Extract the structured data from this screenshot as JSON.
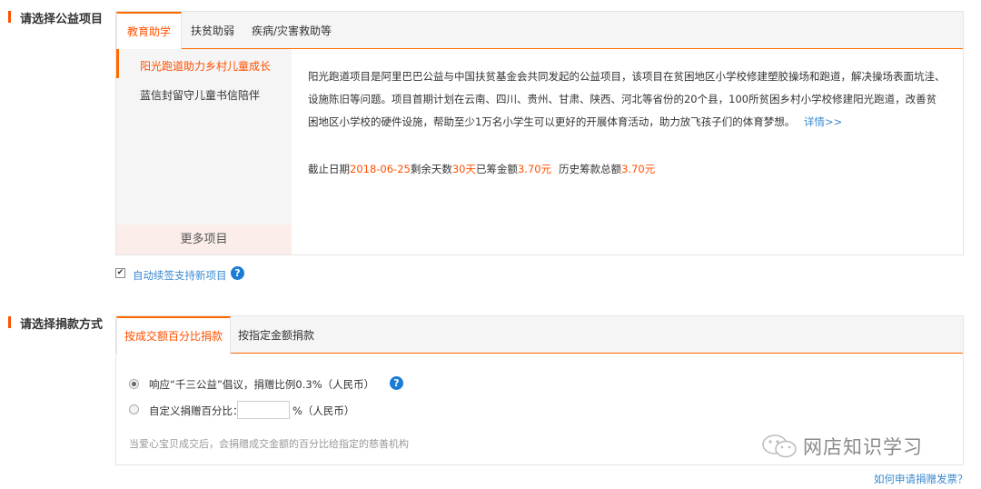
{
  "section1": {
    "label": "请选择公益项目",
    "tabs": [
      "教育助学",
      "扶贫助弱",
      "疾病/灾害救助等"
    ],
    "projects": [
      "阳光跑道助力乡村儿童成长",
      "蓝信封留守儿童书信陪伴"
    ],
    "more": "更多项目",
    "description": "阳光跑道项目是阿里巴巴公益与中国扶贫基金会共同发起的公益项目，该项目在贫困地区小学校修建塑胶操场和跑道，解决操场表面坑洼、设施陈旧等问题。项目首期计划在云南、四川、贵州、甘肃、陕西、河北等省份的20个县，100所贫困乡村小学校修建阳光跑道，改善贫困地区小学校的硬件设施，帮助至少1万名小学生可以更好的开展体育活动，助力放飞孩子们的体育梦想。",
    "detail_link": "详情>>",
    "stats": {
      "deadline_label": "截止日期",
      "deadline": "2018-06-25",
      "remaining_label": "剩余天数",
      "remaining": "30天",
      "raised_label": "已筹金额",
      "raised": "3.70元",
      "history_label": "历史筹款总额",
      "history": "3.70元"
    },
    "auto_renew": "自动续签支持新项目",
    "help": "?"
  },
  "section2": {
    "label": "请选择捐款方式",
    "tabs": [
      "按成交额百分比捐款",
      "按指定金额捐款"
    ],
    "option1": "响应“千三公益”倡议，捐赠比例0.3%（人民币）",
    "option2_prefix": "自定义捐赠百分比：",
    "option2_suffix": "%（人民币）",
    "note": "当爱心宝贝成交后，会捐赠成交金额的百分比给指定的慈善机构",
    "help": "?"
  },
  "watermark": "网店知识学习",
  "invoice_link": "如何申请捐赠发票？",
  "colors": {
    "accent": "#ff5000",
    "link": "#3a88cf",
    "help": "#1a7cd6"
  }
}
